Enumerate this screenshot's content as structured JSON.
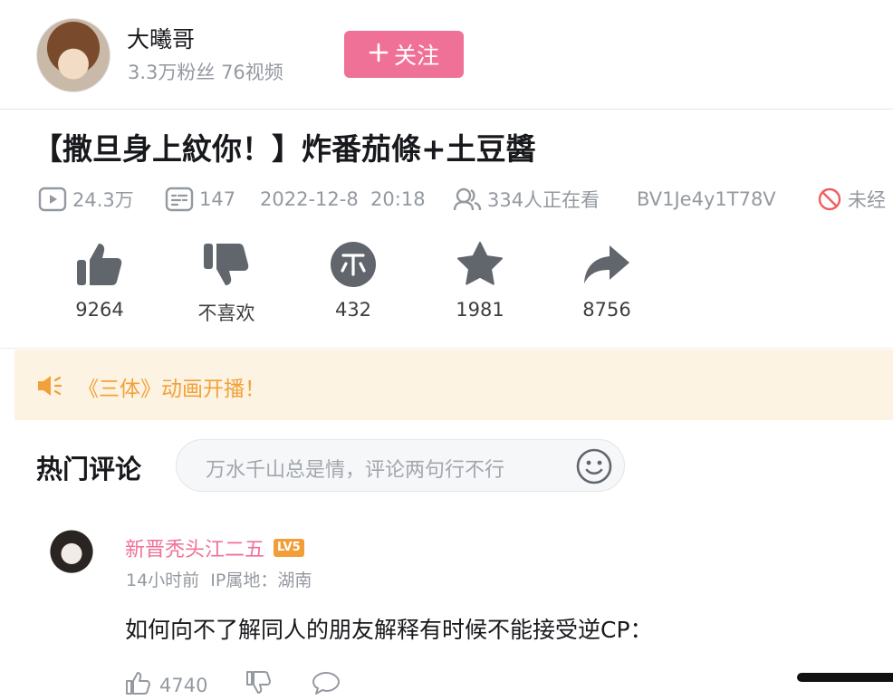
{
  "uploader": {
    "name": "大曦哥",
    "stats": "3.3万粉丝 76视频",
    "follow_label": "关注"
  },
  "video": {
    "title": "【撒旦身上紋你！】炸番茄條+土豆醬",
    "views": "24.3万",
    "danmaku": "147",
    "date": "2022-12-8  20:18",
    "watching": "334人正在看",
    "bvid": "BV1Je4y1T78V",
    "status": "未经"
  },
  "actions": {
    "like": "9264",
    "dislike": "不喜欢",
    "coin": "432",
    "favorite": "1981",
    "share": "8756"
  },
  "notice": {
    "text": "《三体》动画开播！"
  },
  "comments": {
    "title": "热门评论",
    "placeholder": "万水千山总是情，评论两句行不行",
    "items": [
      {
        "user": "新晋秃头江二五",
        "level": "LV5",
        "meta": "14小时前  IP属地：湖南",
        "text": "如何向不了解同人的朋友解释有时候不能接受逆CP：",
        "likes": "4740"
      }
    ]
  },
  "colors": {
    "brand_pink": "#f07197",
    "notice_orange": "#f1a13a",
    "notice_bg": "#fdf3e2",
    "icon_gray": "#61666d",
    "text_secondary": "#9499a0"
  }
}
